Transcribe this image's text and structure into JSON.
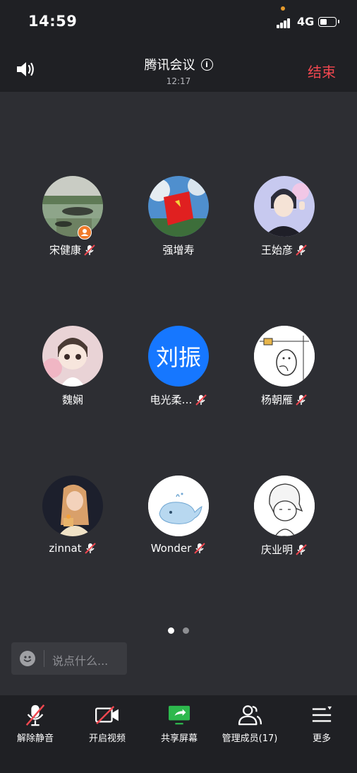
{
  "status_bar": {
    "time": "14:59",
    "network": "4G"
  },
  "header": {
    "title": "腾讯会议",
    "info_icon": "i",
    "elapsed": "12:17",
    "end_label": "结束"
  },
  "members": [
    {
      "name": "宋健康",
      "muted": true,
      "host": true
    },
    {
      "name": "强增寿",
      "muted": false
    },
    {
      "name": "王始彦",
      "muted": true
    },
    {
      "name": "魏娴",
      "muted": false
    },
    {
      "name": "电光柔…",
      "muted": true,
      "avatar_text": "刘振"
    },
    {
      "name": "杨朝雁",
      "muted": true
    },
    {
      "name": "zinnat",
      "muted": true
    },
    {
      "name": "Wonder",
      "muted": true
    },
    {
      "name": "庆业明",
      "muted": true
    }
  ],
  "pager": {
    "pages": 2,
    "current": 1
  },
  "chat": {
    "placeholder": "说点什么..."
  },
  "toolbar": {
    "unmute": "解除静音",
    "video": "开启视频",
    "share": "共享屏幕",
    "manage": "管理成员(17)",
    "more": "更多"
  },
  "colors": {
    "end": "#f0474f",
    "share": "#2db84d",
    "avatar_blue": "#1677ff",
    "host_badge": "#f07b2a"
  }
}
